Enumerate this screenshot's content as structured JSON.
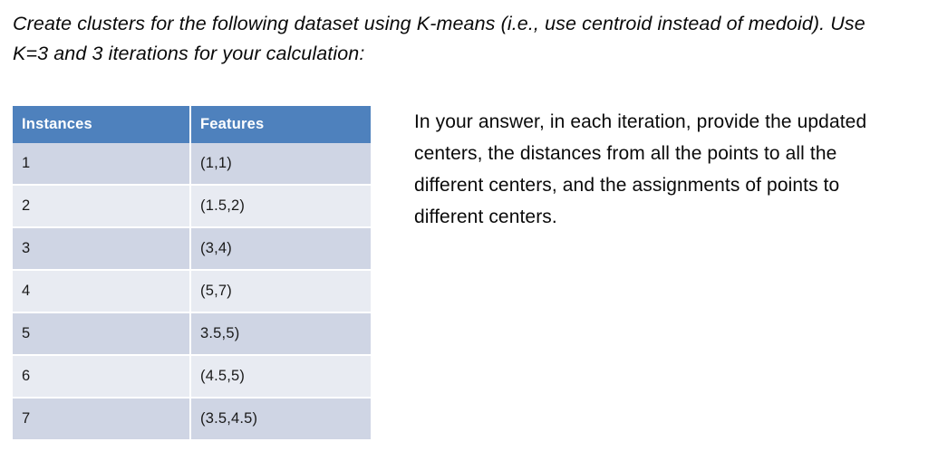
{
  "prompt": {
    "heading": "Create clusters for the following dataset using K-means (i.e., use centroid instead of medoid). Use K=3 and 3 iterations for your calculation:"
  },
  "instruction": {
    "paragraph": "In your answer, in each iteration, provide the updated centers, the distances from all the points to all the different centers, and the assignments of points to different centers."
  },
  "table": {
    "headers": [
      "Instances",
      "Features"
    ],
    "rows": [
      {
        "instance": "1",
        "features": "(1,1)"
      },
      {
        "instance": "2",
        "features": "(1.5,2)"
      },
      {
        "instance": "3",
        "features": "(3,4)"
      },
      {
        "instance": "4",
        "features": "(5,7)"
      },
      {
        "instance": "5",
        "features": "3.5,5)"
      },
      {
        "instance": "6",
        "features": "(4.5,5)"
      },
      {
        "instance": "7",
        "features": "(3.5,4.5)"
      }
    ]
  },
  "colors": {
    "header_blue": "#4E81BD",
    "row_dark": "#CFD5E4",
    "row_light": "#E8EBF2",
    "text": "#000000",
    "header_text": "#FFFFFF",
    "background": "#FFFFFF"
  }
}
